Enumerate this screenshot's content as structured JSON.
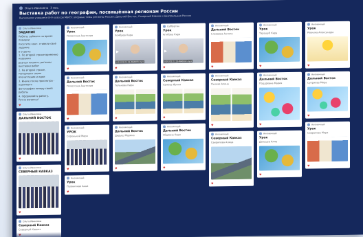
{
  "header": {
    "author": "Ольга Ивановна",
    "time": "3 мес.",
    "title": "Выставка работ по географии, посвящённая регионам России",
    "description": "Выполнили учащиеся 8–9 классов МБОУ: опорные темы регионы России: Дальний Восток, Северный Кавказ и Центральная Россия"
  },
  "columns": [
    {
      "cards": [
        {
          "type": "text",
          "author": "Ольга Ивановна",
          "title": "ЗАДАНИЕ",
          "lines": [
            "Ребята, займите на время позиции",
            "посетите конт. ставили своё задание",
            "в отделе:",
            "1. По второй строке временно названия",
            "разных пишите, регионы выставки работ",
            "2. На второй строке, материалы своих",
            "впечатления и идеи",
            "3. Иначе после просмотра - оценивать",
            "фотографии между своей работы",
            "4. Оформляйте работу.",
            "Ручно вопросы!"
          ],
          "likes": ""
        },
        {
          "type": "photo",
          "author": "Ольга Ивановна",
          "title": "ДАЛЬНИЙ ВОСТОК",
          "pattern": "p-class",
          "size": "tall",
          "likes": ""
        },
        {
          "type": "photo",
          "author": "Ольга Ивановна",
          "title": "СЕВЕРНЫЙ КАВКАЗ",
          "pattern": "p-class",
          "size": "tall",
          "likes": ""
        },
        {
          "type": "plain",
          "author": "Ольга Ивановна",
          "title": "Северный Кавказ",
          "subtitle": "Северный Кавказ"
        }
      ]
    },
    {
      "cards": [
        {
          "type": "photo",
          "author": "Анонимный",
          "title": "Урок",
          "subtitle": "Полесская Анатолия",
          "pattern": "p-map",
          "size": "",
          "likes": ""
        },
        {
          "type": "photo",
          "author": "Анонимный",
          "title": "Дальний Восток",
          "subtitle": "Полесская Анатолия",
          "pattern": "p-poster2",
          "size": "",
          "likes": ""
        },
        {
          "type": "photo",
          "author": "Анонимный",
          "title": "УРОК",
          "subtitle": "Серенький Мира",
          "pattern": "p-class",
          "size": "",
          "likes": ""
        },
        {
          "type": "plain",
          "author": "Анонимный",
          "title": "Урок",
          "subtitle": "Пшеничная Анна"
        }
      ]
    },
    {
      "cards": [
        {
          "type": "video",
          "author": "Анонимный",
          "title": "Урок",
          "subtitle": "Хомбрев Кира",
          "pattern": "p-video",
          "caption": "VID-20211123-WA0003.mp4",
          "likes": ""
        },
        {
          "type": "photo",
          "author": "Анонимный",
          "title": "Дальний Восток",
          "subtitle": "Тельнова Кира",
          "pattern": "p-poster",
          "size": "",
          "likes": ""
        },
        {
          "type": "photo",
          "author": "Анонимный",
          "title": "Дальний Восток",
          "subtitle": "Дидыш Марина",
          "pattern": "p-mountains",
          "size": "",
          "likes": ""
        }
      ]
    },
    {
      "cards": [
        {
          "type": "video",
          "author": "Суббуртин",
          "title": "Урок",
          "subtitle": "Агибова Кира",
          "pattern": "p-video",
          "caption": "VID-20211123-WA0002.mp4",
          "likes": ""
        },
        {
          "type": "photo",
          "author": "Анонимный",
          "title": "Северный Кавказ",
          "subtitle": "Хамова Ирина",
          "pattern": "p-poster",
          "size": "",
          "likes": ""
        },
        {
          "type": "photo",
          "author": "Анонимный",
          "title": "Дальний Восток",
          "subtitle": "Абдевна Кира",
          "pattern": "p-map",
          "size": "",
          "likes": ""
        }
      ]
    },
    {
      "cards": [
        {
          "type": "photo",
          "author": "Анонимный",
          "title": "Дальний Восток",
          "subtitle": "Слоевова Ангела",
          "pattern": "p-poster2",
          "size": "",
          "likes": ""
        },
        {
          "type": "photo",
          "author": "Анонимный",
          "title": "Северный Кавказ",
          "subtitle": "Пьяная Алина",
          "pattern": "p-poster",
          "size": "tall",
          "likes": ""
        },
        {
          "type": "photo",
          "author": "Анонимный",
          "title": "Северный Кавказ",
          "subtitle": "Свирилова Алица",
          "pattern": "p-mountains",
          "size": "tall",
          "likes": ""
        }
      ]
    },
    {
      "cards": [
        {
          "type": "photo",
          "author": "Анонимный",
          "title": "Урок",
          "subtitle": "Тарашуб Кира",
          "pattern": "p-map",
          "size": "",
          "likes": ""
        },
        {
          "type": "photo",
          "author": "Анонимный",
          "title": "Дальний Восток",
          "subtitle": "Поддревна Мария",
          "pattern": "p-colorful",
          "size": "tall",
          "likes": ""
        },
        {
          "type": "photo",
          "author": "Анонимный",
          "title": "Урок",
          "subtitle": "Дольцев Алма",
          "pattern": "p-map",
          "size": "",
          "likes": ""
        }
      ]
    },
    {
      "cards": [
        {
          "type": "photo",
          "author": "Анонимный",
          "title": "Урок",
          "subtitle": "Ревкина Александра",
          "pattern": "p-yellow",
          "size": "",
          "likes": ""
        },
        {
          "type": "photo",
          "author": "Анонимный",
          "title": "Дальний Восток",
          "subtitle": "Суприева Мира",
          "pattern": "p-colorful",
          "size": "",
          "likes": ""
        },
        {
          "type": "photo",
          "author": "Анонимный",
          "title": "Урок",
          "subtitle": "Савранова Мира",
          "pattern": "p-poster2",
          "size": "",
          "likes": ""
        }
      ]
    }
  ]
}
